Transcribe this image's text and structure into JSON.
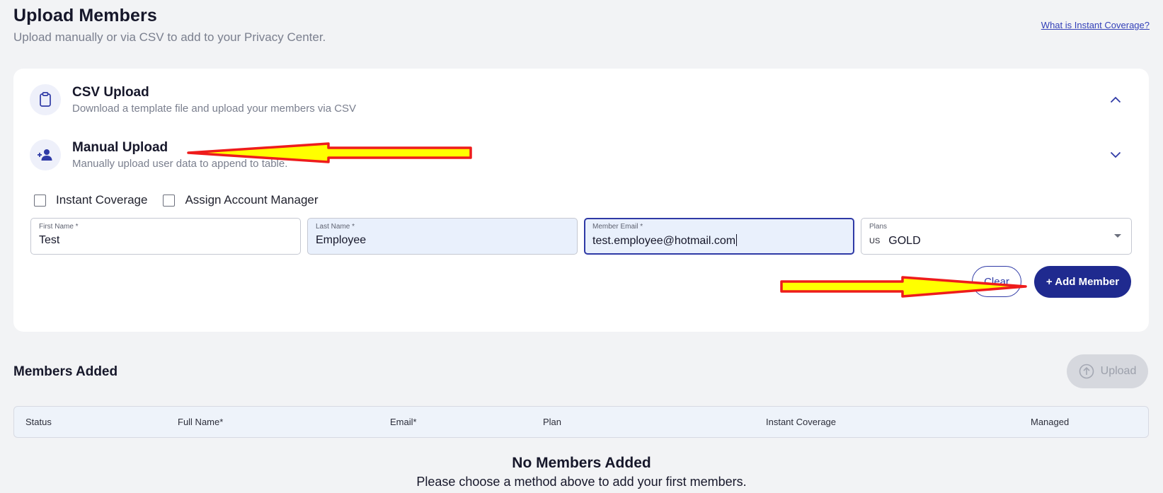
{
  "header": {
    "title": "Upload Members",
    "subtitle": "Upload manually or via CSV to add to your Privacy Center.",
    "help_link": "What is Instant Coverage?"
  },
  "csv_section": {
    "title": "CSV Upload",
    "description": "Download a template file and upload your members via CSV",
    "icon": "clipboard-icon",
    "chevron": "chevron-up-icon"
  },
  "manual_section": {
    "title": "Manual Upload",
    "description": "Manually upload user data to append to table.",
    "icon": "add-person-icon",
    "chevron": "chevron-down-icon"
  },
  "checkboxes": {
    "instant_coverage": "Instant Coverage",
    "assign_account_manager": "Assign Account Manager"
  },
  "form": {
    "first_name": {
      "label": "First Name *",
      "value": "Test"
    },
    "last_name": {
      "label": "Last Name *",
      "value": "Employee"
    },
    "email": {
      "label": "Member Email *",
      "value": "test.employee@hotmail.com"
    },
    "plans": {
      "label": "Plans",
      "flag": "US",
      "value": "GOLD"
    }
  },
  "buttons": {
    "clear": "Clear",
    "add_member": "+ Add Member",
    "upload": "Upload"
  },
  "members": {
    "title": "Members Added",
    "columns": [
      "Status",
      "Full Name*",
      "Email*",
      "Plan",
      "Instant Coverage",
      "Managed"
    ],
    "empty_title": "No Members Added",
    "empty_desc": "Please choose a method above to add your first members."
  },
  "colors": {
    "primary": "#1f2a8f",
    "annotation_fill": "#ffff00",
    "annotation_stroke": "#ee1c1c"
  }
}
